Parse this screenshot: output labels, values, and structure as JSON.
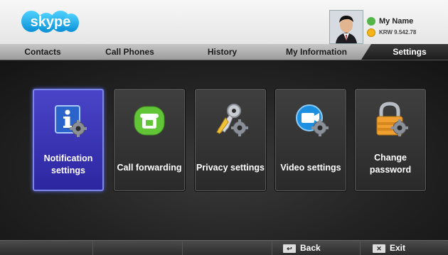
{
  "header": {
    "logo_text": "skype",
    "user_name": "My Name",
    "user_credit": "KRW 9.542.78"
  },
  "tabs": [
    {
      "label": "Contacts"
    },
    {
      "label": "Call Phones"
    },
    {
      "label": "History"
    },
    {
      "label": "My Information"
    },
    {
      "label": "Settings",
      "active": true
    }
  ],
  "tiles": [
    {
      "line1": "Notification",
      "line2": "settings",
      "icon": "notification-settings-icon",
      "selected": true
    },
    {
      "line1": "Call forwarding",
      "icon": "call-forwarding-icon"
    },
    {
      "line1": "Privacy settings",
      "icon": "privacy-settings-icon"
    },
    {
      "line1": "Video settings",
      "icon": "video-settings-icon"
    },
    {
      "line1": "Change",
      "line2": "password",
      "icon": "change-password-icon"
    }
  ],
  "footer": {
    "back_key": "↩",
    "back_label": "Back",
    "exit_key": "✕",
    "exit_label": "Exit"
  },
  "colors": {
    "accent": "#3a33b8",
    "skype_blue": "#00aff0",
    "header_bg": "#eeeeee"
  }
}
